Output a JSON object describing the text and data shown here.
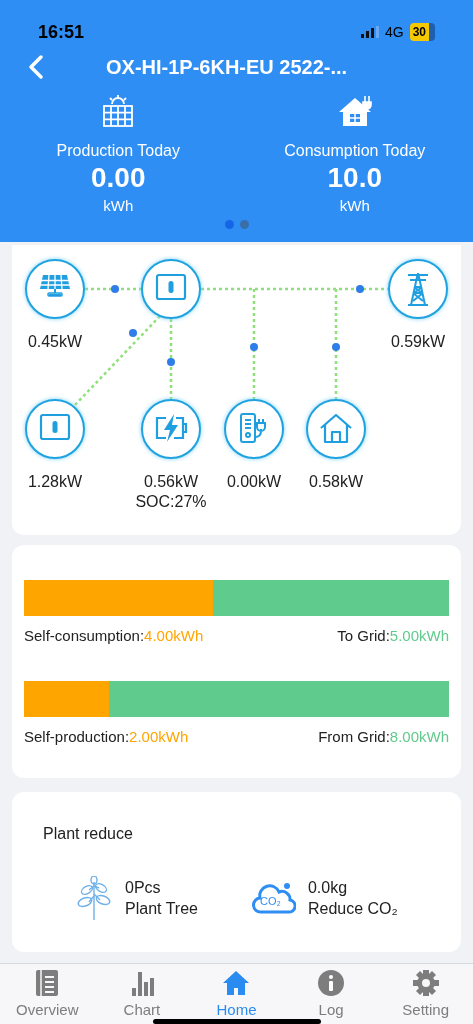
{
  "status_bar": {
    "time": "16:51",
    "network": "4G",
    "battery": "30"
  },
  "header": {
    "title": "OX-HI-1P-6KH-EU 2522-...",
    "stats": [
      {
        "kind": "production",
        "label": "Production Today",
        "value": "0.00",
        "unit": "kWh"
      },
      {
        "kind": "consumption",
        "label": "Consumption Today",
        "value": "10.0",
        "unit": "kWh"
      }
    ],
    "pager": [
      {
        "selected": true
      },
      {
        "selected": false
      }
    ]
  },
  "flow": {
    "nodes": [
      {
        "kind": "solar",
        "reading": "0.45kW"
      },
      {
        "kind": "inverter"
      },
      {
        "kind": "grid",
        "reading": "0.59kW"
      },
      {
        "kind": "inverter2",
        "reading": "1.28kW"
      },
      {
        "kind": "battery",
        "reading": "0.56kW",
        "soc": "SOC:27%"
      },
      {
        "kind": "charger",
        "reading": "0.00kW"
      },
      {
        "kind": "home",
        "reading": "0.58kW"
      }
    ]
  },
  "energy_bars": [
    {
      "level": 0.444,
      "left_label": "Self-consumption:",
      "left_value": "4.00kWh",
      "right_label": "To Grid:",
      "right_value": "5.00kWh"
    },
    {
      "level": 0.2,
      "left_label": "Self-production:",
      "left_value": "2.00kWh",
      "right_label": "From Grid:",
      "right_value": "8.00kWh"
    }
  ],
  "plant_reduce": {
    "title": "Plant reduce",
    "items": [
      {
        "kind": "tree",
        "value": "0Pcs",
        "label": "Plant Tree"
      },
      {
        "kind": "co2",
        "icon_text": "CO₂",
        "value": "0.0kg",
        "label": "Reduce CO₂"
      }
    ]
  },
  "tabs": [
    {
      "kind": "overview",
      "label": "Overview",
      "selected": false
    },
    {
      "kind": "chart",
      "label": "Chart",
      "selected": false
    },
    {
      "kind": "home",
      "label": "Home",
      "selected": true
    },
    {
      "kind": "log",
      "label": "Log",
      "selected": false
    },
    {
      "kind": "setting",
      "label": "Setting",
      "selected": false
    }
  ]
}
